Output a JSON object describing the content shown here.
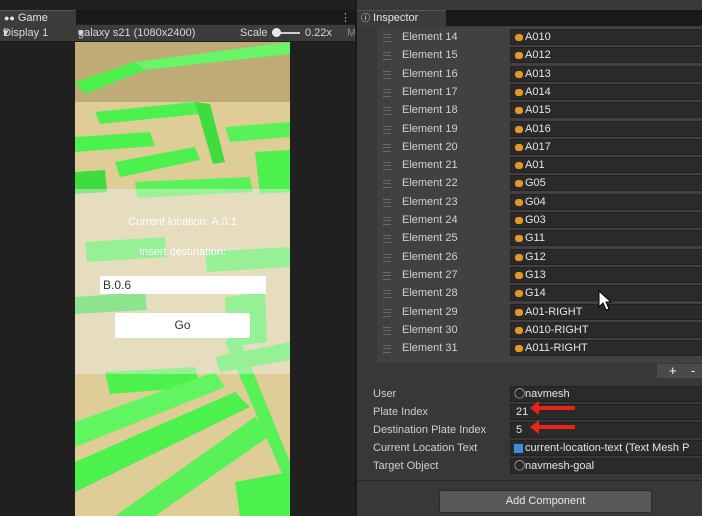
{
  "game_panel": {
    "tab_label": "Game",
    "display_label": "Display 1",
    "resolution_label": "galaxy s21 (1080x2400)",
    "scale_label": "Scale",
    "scale_value": "0.22x",
    "scale_level": 0.2,
    "viewport": {
      "current_location_text": "Current location: A.0.1",
      "insert_destination_text": "Insert destination:",
      "input_value": "B.0.6",
      "button_label": "Go"
    }
  },
  "inspector": {
    "tab_label": "Inspector",
    "elements": [
      {
        "label": "Element 14",
        "value": "A010"
      },
      {
        "label": "Element 15",
        "value": "A012"
      },
      {
        "label": "Element 16",
        "value": "A013"
      },
      {
        "label": "Element 17",
        "value": "A014"
      },
      {
        "label": "Element 18",
        "value": "A015"
      },
      {
        "label": "Element 19",
        "value": "A016"
      },
      {
        "label": "Element 20",
        "value": "A017"
      },
      {
        "label": "Element 21",
        "value": "A01"
      },
      {
        "label": "Element 22",
        "value": "G05"
      },
      {
        "label": "Element 23",
        "value": "G04"
      },
      {
        "label": "Element 24",
        "value": "G03"
      },
      {
        "label": "Element 25",
        "value": "G11"
      },
      {
        "label": "Element 26",
        "value": "G12"
      },
      {
        "label": "Element 27",
        "value": "G13"
      },
      {
        "label": "Element 28",
        "value": "G14"
      },
      {
        "label": "Element 29",
        "value": "A01-RIGHT"
      },
      {
        "label": "Element 30",
        "value": "A010-RIGHT"
      },
      {
        "label": "Element 31",
        "value": "A011-RIGHT"
      }
    ],
    "add_symbol": "+",
    "remove_symbol": "-",
    "properties": {
      "user": {
        "label": "User",
        "value": "navmesh"
      },
      "plate_index": {
        "label": "Plate Index",
        "value": "21"
      },
      "destination_plate_index": {
        "label": "Destination Plate Index",
        "value": "5"
      },
      "current_location_text": {
        "label": "Current Location Text",
        "value": "current-location-text (Text Mesh P"
      },
      "target_object": {
        "label": "Target Object",
        "value": "navmesh-goal"
      }
    },
    "add_component_label": "Add Component"
  },
  "colors": {
    "asset_dot": "#e8962a",
    "annotation_arrow": "#e8231b",
    "wall_green": "#3ef03e",
    "floor": "#dcc98e"
  }
}
